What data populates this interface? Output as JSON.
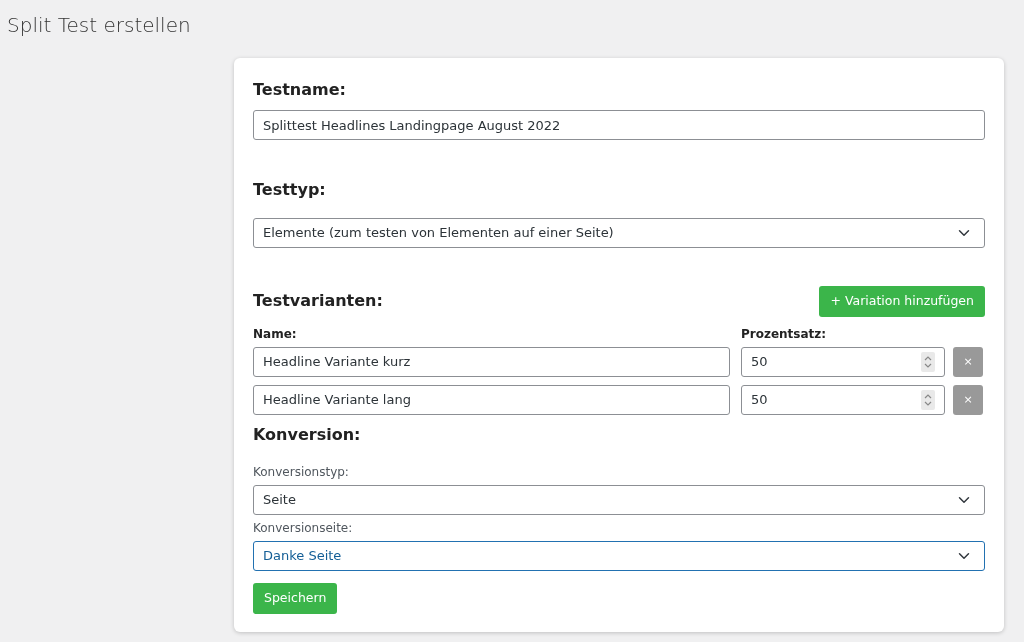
{
  "page_title": "Split Test erstellen",
  "testname": {
    "label": "Testname:",
    "value": "Splittest Headlines Landingpage August 2022"
  },
  "testtype": {
    "label": "Testtyp:",
    "value": "Elemente (zum testen von Elementen auf einer Seite)"
  },
  "variants": {
    "heading": "Testvarianten:",
    "add_button": "+ Variation hinzufügen",
    "name_label": "Name:",
    "percent_label": "Prozentsatz:",
    "rows": [
      {
        "name": "Headline Variante kurz",
        "percent": "50",
        "remove": "×"
      },
      {
        "name": "Headline Variante lang",
        "percent": "50",
        "remove": "×"
      }
    ]
  },
  "conversion": {
    "heading": "Konversion:",
    "fields": [
      {
        "label": "Konversionstyp:",
        "value": "Seite",
        "focused": false
      },
      {
        "label": "Konversionseite:",
        "value": "Danke Seite",
        "focused": true
      }
    ]
  },
  "save_button": "Speichern"
}
